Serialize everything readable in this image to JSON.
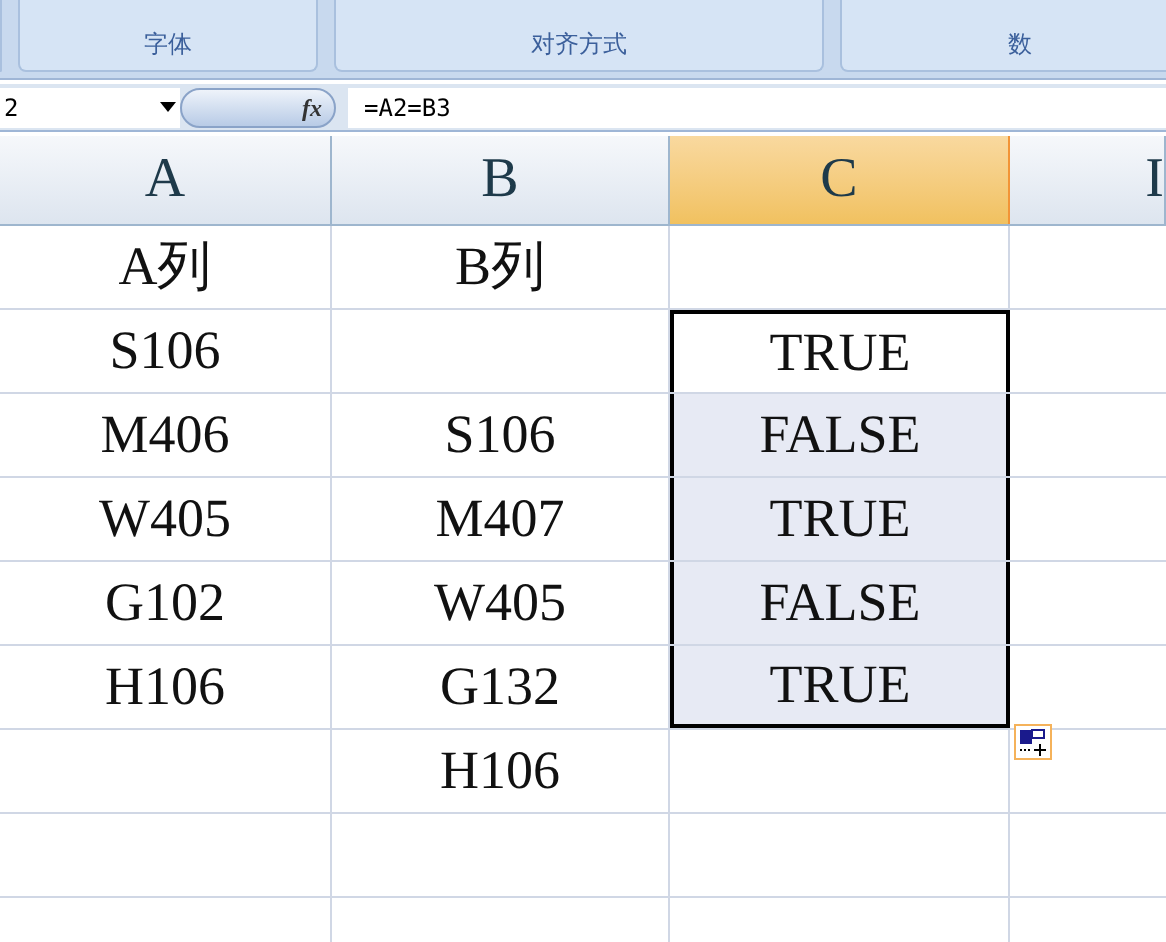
{
  "ribbon": {
    "groups": [
      {
        "label": "字体"
      },
      {
        "label": "对齐方式"
      },
      {
        "label": "数"
      }
    ]
  },
  "formula_bar": {
    "name_box": "2",
    "fx": "fx",
    "formula": "=A2=B3"
  },
  "columns": [
    {
      "label": "A",
      "selected": false
    },
    {
      "label": "B",
      "selected": false
    },
    {
      "label": "C",
      "selected": true
    },
    {
      "label": "I",
      "selected": false
    }
  ],
  "rows": [
    {
      "cells": [
        {
          "text": "A列",
          "selected": false
        },
        {
          "text": "B列",
          "selected": false
        },
        {
          "text": "",
          "selected": false
        }
      ]
    },
    {
      "cells": [
        {
          "text": "S106",
          "selected": false
        },
        {
          "text": "",
          "selected": false
        },
        {
          "text": "TRUE",
          "selected": true,
          "active": true
        }
      ]
    },
    {
      "cells": [
        {
          "text": "M406",
          "selected": false
        },
        {
          "text": "S106",
          "selected": false
        },
        {
          "text": "FALSE",
          "selected": true,
          "active": false
        }
      ]
    },
    {
      "cells": [
        {
          "text": "W405",
          "selected": false
        },
        {
          "text": "M407",
          "selected": false
        },
        {
          "text": "TRUE",
          "selected": true,
          "active": false
        }
      ]
    },
    {
      "cells": [
        {
          "text": "G102",
          "selected": false
        },
        {
          "text": "W405",
          "selected": false
        },
        {
          "text": "FALSE",
          "selected": true,
          "active": false
        }
      ]
    },
    {
      "cells": [
        {
          "text": "H106",
          "selected": false
        },
        {
          "text": "G132",
          "selected": false
        },
        {
          "text": "TRUE",
          "selected": true,
          "active": false
        }
      ]
    },
    {
      "cells": [
        {
          "text": "",
          "selected": false
        },
        {
          "text": "H106",
          "selected": false
        },
        {
          "text": "",
          "selected": false
        }
      ]
    },
    {
      "cells": [
        {
          "text": "",
          "selected": false
        },
        {
          "text": "",
          "selected": false
        },
        {
          "text": "",
          "selected": false
        }
      ]
    },
    {
      "cells": [
        {
          "text": "",
          "selected": false
        },
        {
          "text": "",
          "selected": false
        },
        {
          "text": "",
          "selected": false
        }
      ]
    }
  ]
}
